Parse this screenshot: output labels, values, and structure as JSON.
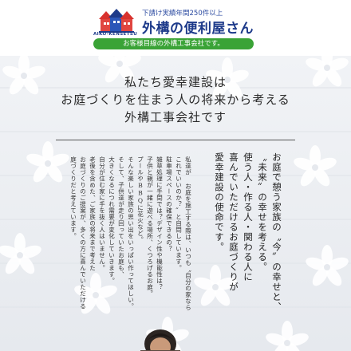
{
  "header": {
    "brand_en": "AIKO-KENSETSU",
    "tagline": "下請け実績年間250件以上",
    "title": "外構の便利屋さん",
    "subtitle": "お客様目線の外構工事会社です。",
    "colors": {
      "brand": "#1d3a8a",
      "accent_green": "#3aa336",
      "roof_red": "#d8322e"
    }
  },
  "hero": {
    "heading_lines": [
      "私たち愛幸建設は",
      "お庭づくりを住まう人の将来から考える",
      "外構工事会社です"
    ],
    "lead_lines": [
      "お庭で憩う家族の〝今〟の幸せと、",
      "〝未来〟の幸せを考える。",
      "使う人・作る人・関わる人に",
      "喜んでいただけるお庭づくりが",
      "愛幸建設の使命です。"
    ],
    "body_lines": [
      "私達が お庭を施工する際は、いつも〝自分の家なら",
      "これでいいのか？〟と自問しています。",
      "駐車場スペースの確保できるの？",
      "雑草処理に手間では？デザイン性や機能性は？",
      "子供と親が一緒に遊べる場所、くつろげるお庭。",
      "プールやBBQに花火など。",
      "そんな楽しい家族の思い出をいっぱい作ってほしい。",
      "そして、子供達が走り回っていたお庭も、",
      "大きくなるにつれ需要が変化していきます。",
      "自分が住む家に手を抜く人はいません。",
      "老後を含めた、ご家族の将来まで考えた",
      "お庭づくりのご提案が、多くの方に喜んでいただける",
      "庭づくりだと考えています。"
    ]
  }
}
